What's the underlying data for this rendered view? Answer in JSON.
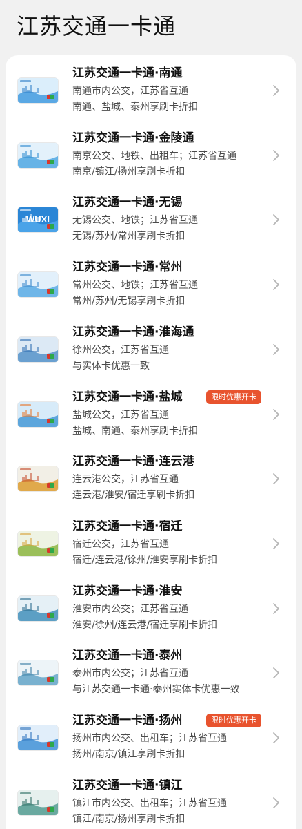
{
  "page": {
    "title": "江苏交通一卡通"
  },
  "list": {
    "items": [
      {
        "title": "江苏交通一卡通·南通",
        "line1": "南通市内公交，江苏省互通",
        "line2": "南通、盐城、泰州享刷卡折扣",
        "card_icon": "nantong-card-icon",
        "card_text": "",
        "promo": ""
      },
      {
        "title": "江苏交通一卡通·金陵通",
        "line1": "南京公交、地铁、出租车；江苏省互通",
        "line2": "南京/镇江/扬州享刷卡折扣",
        "card_icon": "jinlingtong-card-icon",
        "card_text": "",
        "promo": ""
      },
      {
        "title": "江苏交通一卡通·无锡",
        "line1": "无锡公交、地铁；江苏省互通",
        "line2": "无锡/苏州/常州享刷卡折扣",
        "card_icon": "wuxi-card-icon",
        "card_text": "WUXI",
        "promo": ""
      },
      {
        "title": "江苏交通一卡通·常州",
        "line1": "常州公交、地铁；江苏省互通",
        "line2": "常州/苏州/无锡享刷卡折扣",
        "card_icon": "changzhou-card-icon",
        "card_text": "",
        "promo": ""
      },
      {
        "title": "江苏交通一卡通·淮海通",
        "line1": "徐州公交，江苏省互通",
        "line2": "与实体卡优惠一致",
        "card_icon": "huaihaitong-card-icon",
        "card_text": "",
        "promo": ""
      },
      {
        "title": "江苏交通一卡通·盐城",
        "line1": "盐城公交，江苏省互通",
        "line2": "盐城、南通、泰州享刷卡折扣",
        "card_icon": "yancheng-card-icon",
        "card_text": "",
        "promo": "限时优惠开卡"
      },
      {
        "title": "江苏交通一卡通·连云港",
        "line1": "连云港公交，江苏省互通",
        "line2": "连云港/淮安/宿迁享刷卡折扣",
        "card_icon": "lianyungang-card-icon",
        "card_text": "",
        "promo": ""
      },
      {
        "title": "江苏交通一卡通·宿迁",
        "line1": "宿迁公交，江苏省互通",
        "line2": "宿迁/连云港/徐州/淮安享刷卡折扣",
        "card_icon": "suqian-card-icon",
        "card_text": "",
        "promo": ""
      },
      {
        "title": "江苏交通一卡通·淮安",
        "line1": "淮安市内公交；江苏省互通",
        "line2": "淮安/徐州/连云港/宿迁享刷卡折扣",
        "card_icon": "huaian-card-icon",
        "card_text": "",
        "promo": ""
      },
      {
        "title": "江苏交通一卡通·泰州",
        "line1": "泰州市内公交；江苏省互通",
        "line2": "与江苏交通一卡通·泰州实体卡优惠一致",
        "card_icon": "taizhou-card-icon",
        "card_text": "",
        "promo": ""
      },
      {
        "title": "江苏交通一卡通·扬州",
        "line1": "扬州市内公交、出租车；江苏省互通",
        "line2": "扬州/南京/镇江享刷卡折扣",
        "card_icon": "yangzhou-card-icon",
        "card_text": "",
        "promo": "限时优惠开卡"
      },
      {
        "title": "江苏交通一卡通·镇江",
        "line1": "镇江市内公交、出租车；江苏省互通",
        "line2": "镇江/南京/扬州享刷卡折扣",
        "card_icon": "zhenjiang-card-icon",
        "card_text": "",
        "promo": ""
      }
    ]
  },
  "colors": {
    "promo_badge": "#e8532e",
    "chevron": "#b5b5b5",
    "card_blue": "#4f9fe0",
    "card_white": "#eaf4fc"
  }
}
